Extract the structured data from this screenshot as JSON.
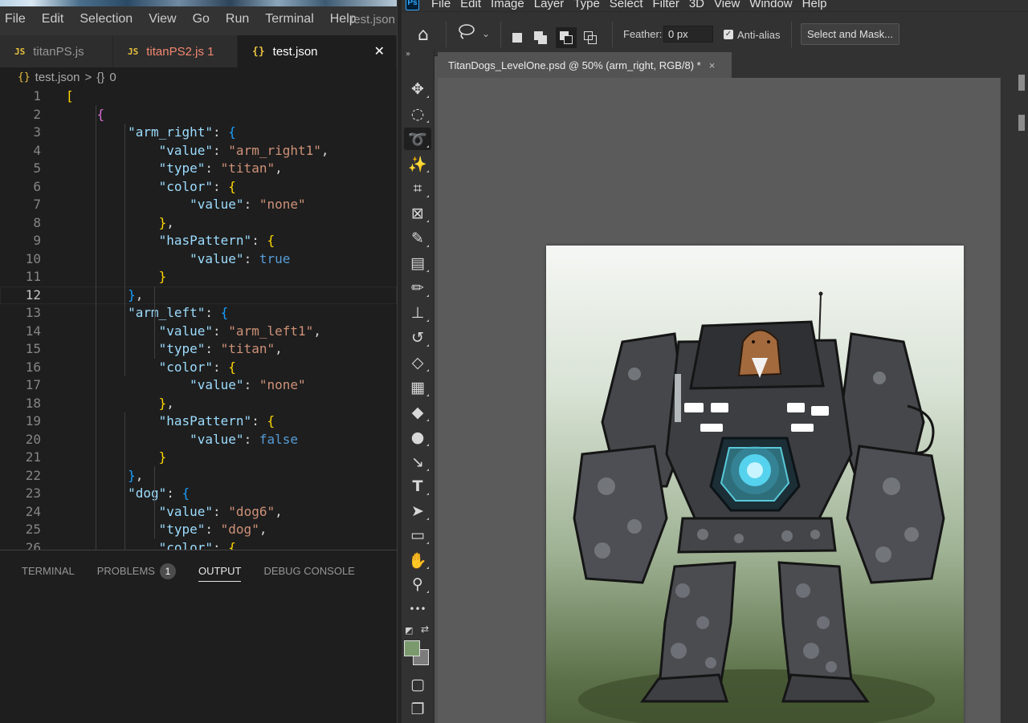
{
  "vscode": {
    "menu": [
      "File",
      "Edit",
      "Selection",
      "View",
      "Go",
      "Run",
      "Terminal",
      "Help"
    ],
    "window_title": "test.json",
    "tabs": [
      {
        "icon": "JS",
        "label": "titanPS.js"
      },
      {
        "icon": "JS",
        "label": "titanPS2.js 1"
      },
      {
        "icon": "{}",
        "label": "test.json",
        "close": "✕"
      }
    ],
    "breadcrumb": {
      "icon": "{}",
      "file": "test.json",
      "separator": ">",
      "symbol_icon": "{}",
      "symbol": "0"
    },
    "code": [
      {
        "n": "1",
        "t": "["
      },
      {
        "n": "2",
        "t": "    {"
      },
      {
        "n": "3",
        "t": "        \"arm_right\": {"
      },
      {
        "n": "4",
        "t": "            \"value\": \"arm_right1\","
      },
      {
        "n": "5",
        "t": "            \"type\": \"titan\","
      },
      {
        "n": "6",
        "t": "            \"color\": {"
      },
      {
        "n": "7",
        "t": "                \"value\": \"none\""
      },
      {
        "n": "8",
        "t": "            },"
      },
      {
        "n": "9",
        "t": "            \"hasPattern\": {"
      },
      {
        "n": "10",
        "t": "                \"value\": true"
      },
      {
        "n": "11",
        "t": "            }"
      },
      {
        "n": "12",
        "t": "        },"
      },
      {
        "n": "13",
        "t": "        \"arm_left\": {"
      },
      {
        "n": "14",
        "t": "            \"value\": \"arm_left1\","
      },
      {
        "n": "15",
        "t": "            \"type\": \"titan\","
      },
      {
        "n": "16",
        "t": "            \"color\": {"
      },
      {
        "n": "17",
        "t": "                \"value\": \"none\""
      },
      {
        "n": "18",
        "t": "            },"
      },
      {
        "n": "19",
        "t": "            \"hasPattern\": {"
      },
      {
        "n": "20",
        "t": "                \"value\": false"
      },
      {
        "n": "21",
        "t": "            }"
      },
      {
        "n": "22",
        "t": "        },"
      },
      {
        "n": "23",
        "t": "        \"dog\": {"
      },
      {
        "n": "24",
        "t": "            \"value\": \"dog6\","
      },
      {
        "n": "25",
        "t": "            \"type\": \"dog\","
      },
      {
        "n": "26",
        "t": "            \"color\": {"
      }
    ],
    "current_line": "12",
    "panel": {
      "tabs": [
        "TERMINAL",
        "PROBLEMS",
        "OUTPUT",
        "DEBUG CONSOLE"
      ],
      "problems_count": "1",
      "active_tab": "OUTPUT"
    }
  },
  "photoshop": {
    "logo": "Ps",
    "menu": [
      "File",
      "Edit",
      "Image",
      "Layer",
      "Type",
      "Select",
      "Filter",
      "3D",
      "View",
      "Window",
      "Help"
    ],
    "options": {
      "feather_label": "Feather:",
      "feather_value": "0 px",
      "anti_alias_label": "Anti-alias",
      "anti_alias_checked": true,
      "select_mask_label": "Select and Mask..."
    },
    "document_tab": {
      "title": "TitanDogs_LevelOne.psd @ 50% (arm_right, RGB/8) *",
      "close": "×"
    },
    "tools": [
      "move-tool",
      "elliptical-marquee-tool",
      "lasso-tool",
      "magic-wand-tool",
      "crop-tool",
      "frame-tool",
      "eyedropper-tool",
      "healing-brush-tool",
      "brush-tool",
      "clone-stamp-tool",
      "history-brush-tool",
      "eraser-tool",
      "gradient-tool",
      "blur-tool",
      "dodge-tool",
      "pen-tool",
      "type-tool",
      "path-selection-tool",
      "rectangle-tool",
      "hand-tool",
      "zoom-tool",
      "more-tools",
      "quick-mask-mode",
      "screen-mode"
    ],
    "active_tool": "lasso-tool",
    "colors": {
      "foreground": "#7a9a6e",
      "background": "#7c7c7c",
      "accent_blue": "#31a8ff"
    }
  }
}
